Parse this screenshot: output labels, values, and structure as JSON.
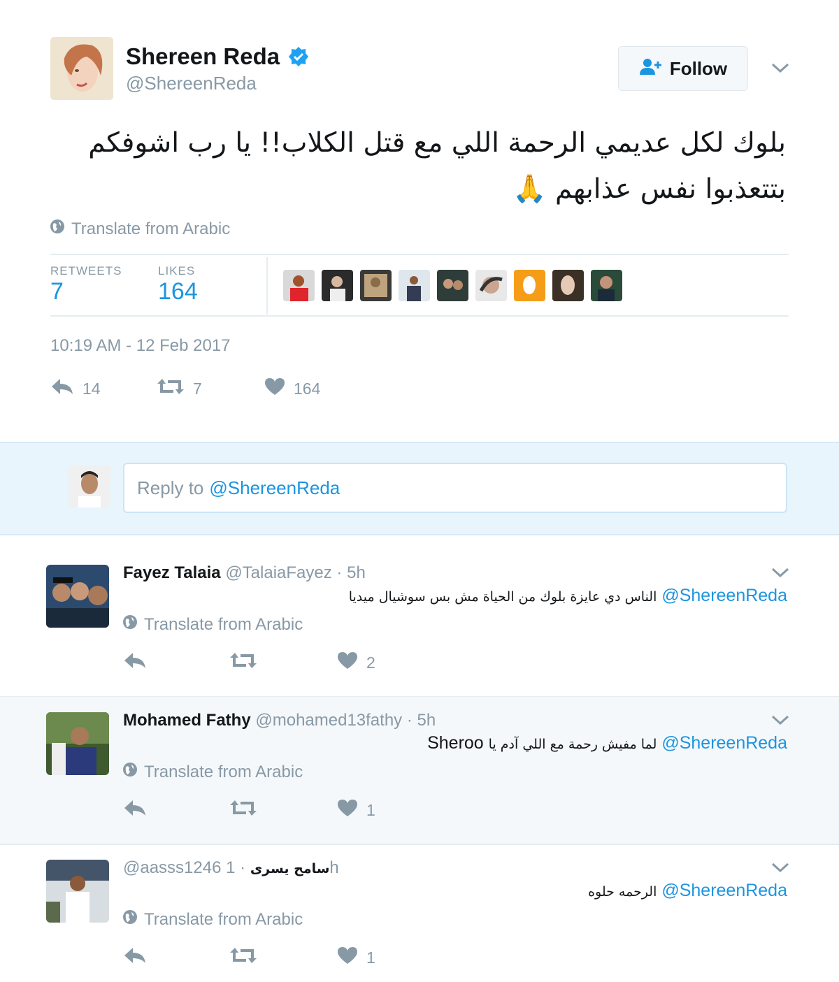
{
  "tweet": {
    "author_name": "Shereen Reda",
    "author_handle": "@ShereenReda",
    "follow_label": "Follow",
    "text_line1": "بلوك لكل عديمي الرحمة اللي مع قتل الكلاب!! يا رب اشوفكم",
    "text_line2": "بتتعذبوا نفس عذابهم 🙏",
    "translate_label": "Translate from Arabic",
    "retweets_label": "RETWEETS",
    "retweets_count": "7",
    "likes_label": "LIKES",
    "likes_count": "164",
    "timestamp": "10:19 AM - 12 Feb 2017",
    "reply_count": "14",
    "retweet_count_action": "7",
    "like_count_action": "164"
  },
  "reply_box": {
    "placeholder_prefix": "Reply to",
    "placeholder_mention": "@ShereenReda"
  },
  "replies": [
    {
      "name": "Fayez Talaia",
      "handle": "@TalaiaFayez",
      "time": "5h",
      "mention": "@ShereenReda",
      "text": "الناس دي عايزة بلوك من الحياة مش بس سوشيال ميديا",
      "text_suffix": "",
      "translate_label": "Translate from Arabic",
      "likes": "2"
    },
    {
      "name": "Mohamed Fathy",
      "handle": "@mohamed13fathy",
      "time": "5h",
      "mention": "@ShereenReda",
      "text": "لما مفيش رحمة مع اللي آدم يا",
      "text_suffix": "Sheroo",
      "translate_label": "Translate from Arabic",
      "likes": "1"
    },
    {
      "name": "سامح يسرى",
      "handle": "@aasss1246",
      "time": "1h",
      "mention": "@ShereenReda",
      "text": "الرحمه حلوه",
      "text_suffix": "",
      "translate_label": "Translate from Arabic",
      "likes": "1"
    }
  ],
  "colors": {
    "accent": "#1b95e0",
    "muted": "#8899a6",
    "reply_highlight": "#f5f8fa"
  }
}
